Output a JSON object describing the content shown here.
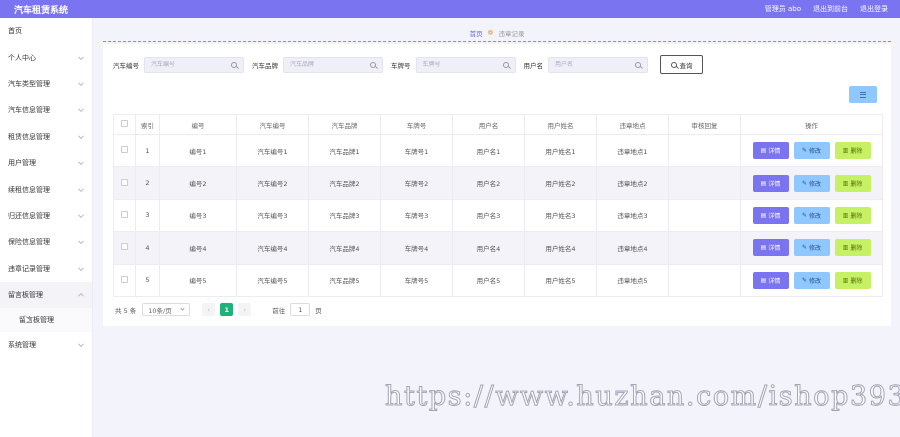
{
  "header": {
    "app_title": "汽车租赁系统",
    "user_label": "管理员 abo",
    "backend_link": "退出到前台",
    "logout_link": "退出登录"
  },
  "sidebar": {
    "items": [
      {
        "label": "首页",
        "has_arrow": false
      },
      {
        "label": "个人中心",
        "has_arrow": true
      },
      {
        "label": "汽车类型管理",
        "has_arrow": true
      },
      {
        "label": "汽车信息管理",
        "has_arrow": true
      },
      {
        "label": "租赁信息管理",
        "has_arrow": true
      },
      {
        "label": "用户管理",
        "has_arrow": true
      },
      {
        "label": "续租信息管理",
        "has_arrow": true
      },
      {
        "label": "归还信息管理",
        "has_arrow": true
      },
      {
        "label": "保险信息管理",
        "has_arrow": true
      },
      {
        "label": "违章记录管理",
        "has_arrow": true
      },
      {
        "label": "留言板管理",
        "has_arrow": true,
        "open": true
      },
      {
        "label": "系统管理",
        "has_arrow": true
      }
    ],
    "submenu_item": "留言板管理"
  },
  "breadcrumb": {
    "home": "首页",
    "current": "违章记录"
  },
  "search": {
    "fields": [
      {
        "label": "汽车编号",
        "placeholder": "汽车编号"
      },
      {
        "label": "汽车品牌",
        "placeholder": "汽车品牌"
      },
      {
        "label": "车牌号",
        "placeholder": "车牌号"
      },
      {
        "label": "用户名",
        "placeholder": "用户名"
      }
    ],
    "query_label": "查询"
  },
  "table": {
    "headers": [
      "索引",
      "编号",
      "汽车编号",
      "汽车品牌",
      "车牌号",
      "用户名",
      "用户姓名",
      "违章地点",
      "审核回复",
      "操作"
    ],
    "rows": [
      [
        "1",
        "编号1",
        "汽车编号1",
        "汽车品牌1",
        "车牌号1",
        "用户名1",
        "用户姓名1",
        "违章地点1",
        ""
      ],
      [
        "2",
        "编号2",
        "汽车编号2",
        "汽车品牌2",
        "车牌号2",
        "用户名2",
        "用户姓名2",
        "违章地点2",
        ""
      ],
      [
        "3",
        "编号3",
        "汽车编号3",
        "汽车品牌3",
        "车牌号3",
        "用户名3",
        "用户姓名3",
        "违章地点3",
        ""
      ],
      [
        "4",
        "编号4",
        "汽车编号4",
        "汽车品牌4",
        "车牌号4",
        "用户名4",
        "用户姓名4",
        "违章地点4",
        ""
      ],
      [
        "5",
        "编号5",
        "汽车编号5",
        "汽车品牌5",
        "车牌号5",
        "用户名5",
        "用户姓名5",
        "违章地点5",
        ""
      ]
    ],
    "actions": {
      "detail": "详情",
      "edit": "修改",
      "delete": "删除"
    }
  },
  "pagination": {
    "total": "共 5 条",
    "page_size": "10条/页",
    "current_page": "1",
    "goto_prefix": "前往",
    "goto_value": "1",
    "goto_suffix": "页"
  },
  "watermark": "https://www.huzhan.com/ishop39397",
  "colors": {
    "primary": "#7b74f0",
    "info": "#8ec8ff",
    "danger_lime": "#c6f165",
    "page_active": "#1fb17a"
  }
}
